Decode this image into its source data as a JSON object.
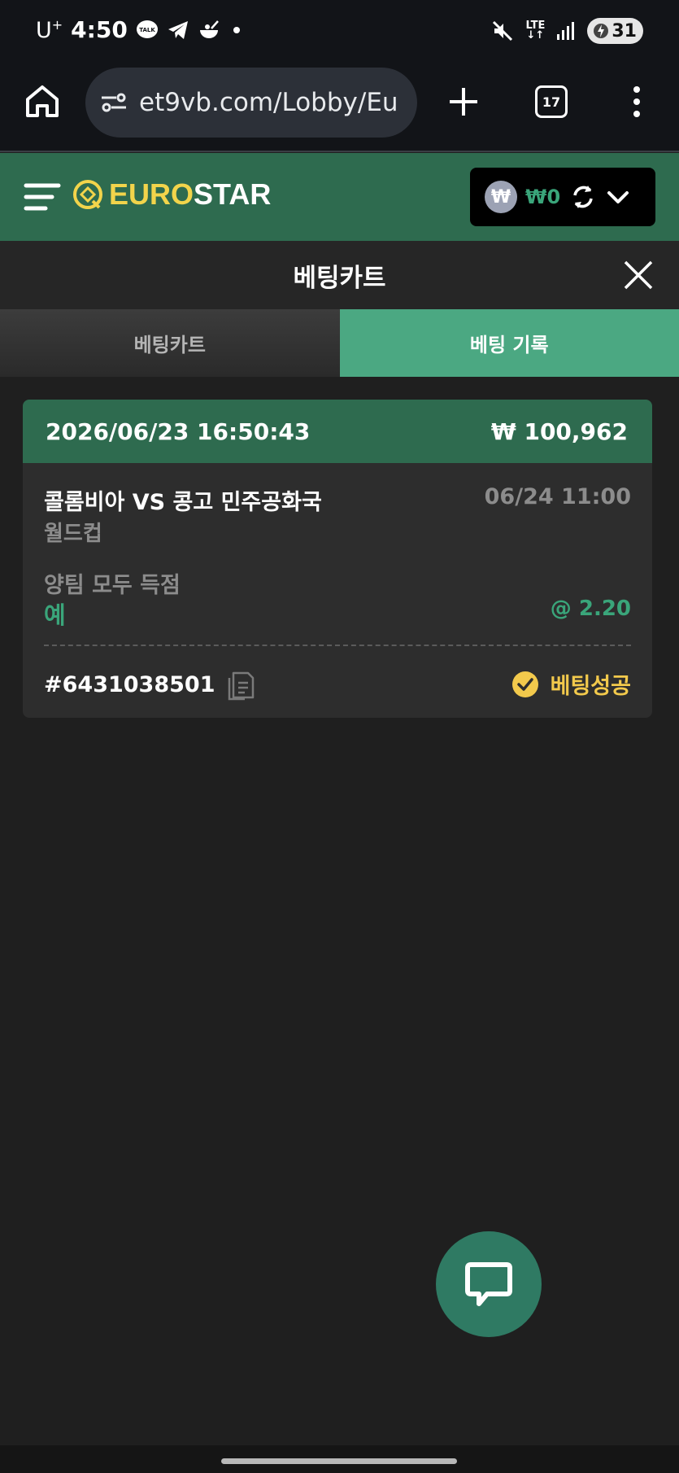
{
  "status_bar": {
    "carrier": "U",
    "carrier_sup": "+",
    "time": "4:50",
    "talk_icon_text": "TALK",
    "network": "LTE",
    "battery": "31"
  },
  "browser": {
    "url": "et9vb.com/Lobby/Eu",
    "tab_count": "17"
  },
  "header": {
    "logo_part1": "EURO",
    "logo_part2": "STAR",
    "currency_badge": "₩",
    "balance": "₩0"
  },
  "cart": {
    "title": "베팅카트",
    "tabs": [
      {
        "label": "베팅카트",
        "active": false
      },
      {
        "label": "베팅 기록",
        "active": true
      }
    ]
  },
  "bet": {
    "datetime": "2026/06/23 16:50:43",
    "amount": "₩ 100,962",
    "match": "콜롬비아 VS 콩고 민주공화국",
    "match_date": "06/24 11:00",
    "league": "월드컵",
    "market": "양팀 모두 득점",
    "pick": "예",
    "odds": "@ 2.20",
    "bet_id": "#6431038501",
    "status": "베팅성공"
  },
  "colors": {
    "header_green": "#2e6b4f",
    "tab_active": "#4ba882",
    "accent_green": "#3aa57a",
    "success_yellow": "#f2c94c",
    "logo_yellow": "#f2d44b"
  }
}
